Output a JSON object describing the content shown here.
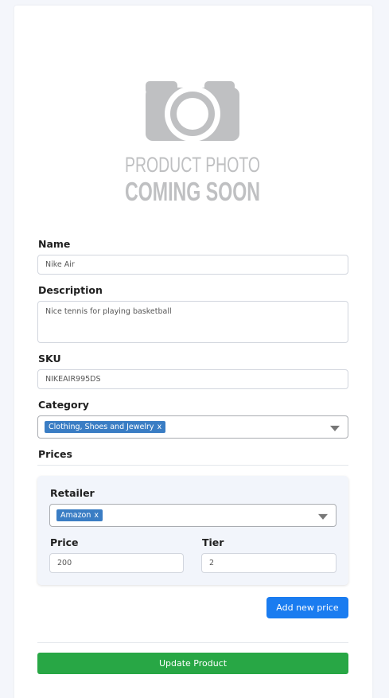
{
  "photo": {
    "line1": "PRODUCT PHOTO",
    "line2": "COMING SOON"
  },
  "form": {
    "name_label": "Name",
    "name_value": "Nike Air",
    "description_label": "Description",
    "description_value": "Nice tennis for playing basketball",
    "sku_label": "SKU",
    "sku_value": "NIKEAIR995DS",
    "category_label": "Category",
    "category_tags": [
      "Clothing, Shoes and Jewelry"
    ],
    "tag_remove": "x",
    "prices_label": "Prices"
  },
  "price_entry": {
    "retailer_label": "Retailer",
    "retailer_tags": [
      "Amazon"
    ],
    "price_label": "Price",
    "price_value": "200",
    "tier_label": "Tier",
    "tier_value": "2"
  },
  "buttons": {
    "add_price": "Add new price",
    "update_product": "Update Product"
  },
  "colors": {
    "tag": "#3a7dc4",
    "add_button": "#1a7cf0",
    "update_button": "#28a745"
  }
}
